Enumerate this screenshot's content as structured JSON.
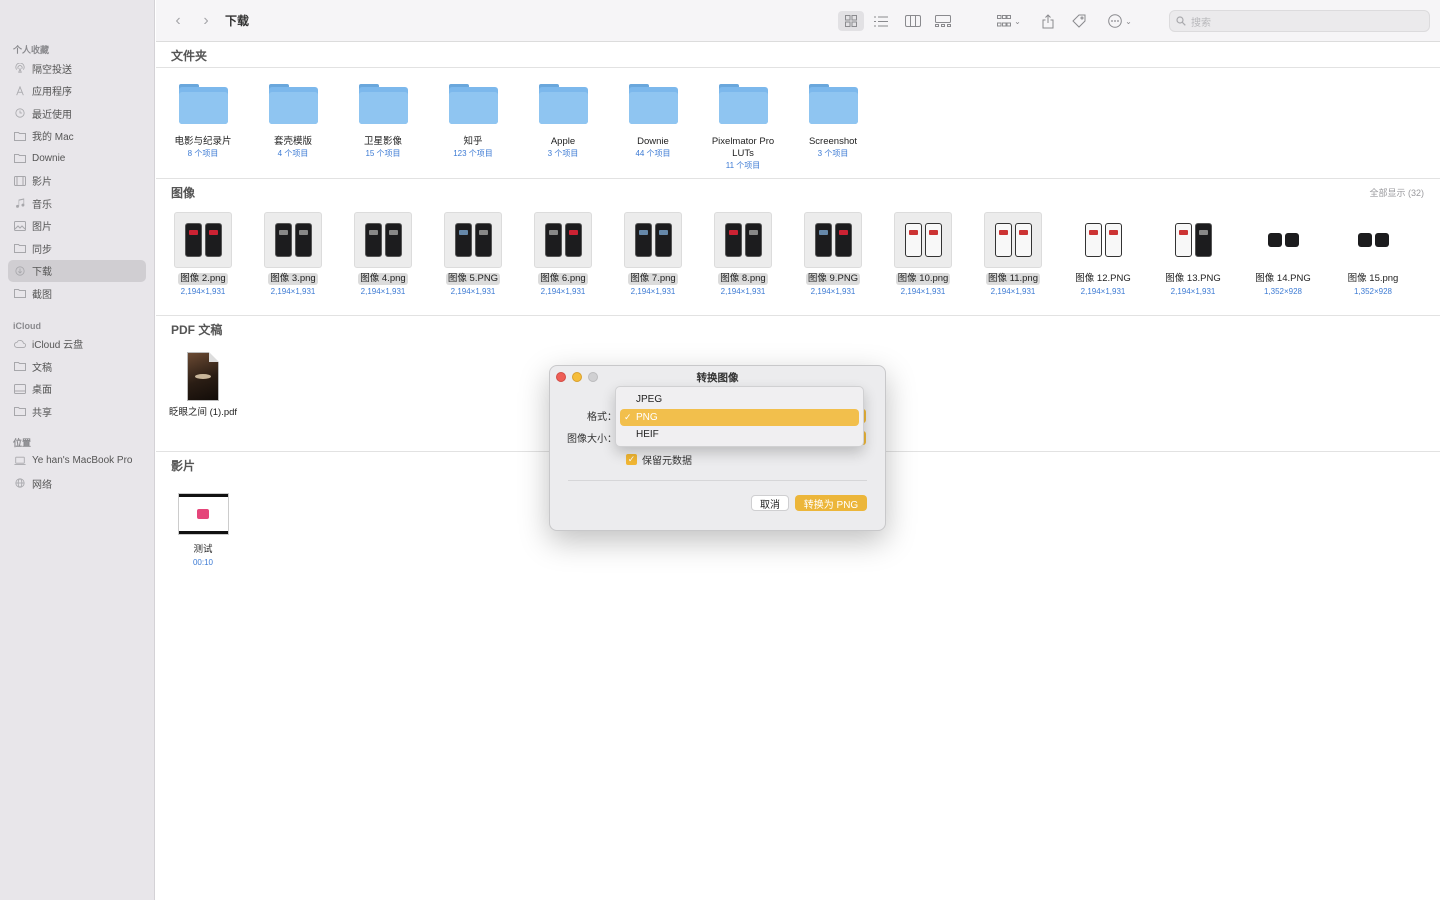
{
  "sidebar": {
    "favorites_title": "个人收藏",
    "favorites": [
      {
        "label": "隔空投送",
        "icon": "airdrop-icon"
      },
      {
        "label": "应用程序",
        "icon": "applications-icon"
      },
      {
        "label": "最近使用",
        "icon": "recents-icon"
      },
      {
        "label": "我的 Mac",
        "icon": "folder-icon"
      },
      {
        "label": "Downie",
        "icon": "folder-icon"
      },
      {
        "label": "影片",
        "icon": "film-icon"
      },
      {
        "label": "音乐",
        "icon": "music-icon"
      },
      {
        "label": "图片",
        "icon": "photo-icon"
      },
      {
        "label": "同步",
        "icon": "folder-icon"
      },
      {
        "label": "下载",
        "icon": "download-icon"
      },
      {
        "label": "截图",
        "icon": "folder-icon"
      }
    ],
    "icloud_title": "iCloud",
    "icloud": [
      {
        "label": "iCloud 云盘",
        "icon": "cloud-icon"
      },
      {
        "label": "文稿",
        "icon": "folder-icon"
      },
      {
        "label": "桌面",
        "icon": "desktop-icon"
      },
      {
        "label": "共享",
        "icon": "shared-folder-icon"
      }
    ],
    "locations_title": "位置",
    "locations": [
      {
        "label": "Ye han's MacBook Pro",
        "icon": "laptop-icon"
      },
      {
        "label": "网络",
        "icon": "globe-icon"
      }
    ]
  },
  "toolbar": {
    "title": "下载",
    "search_placeholder": "搜索"
  },
  "sections": {
    "folders": "文件夹",
    "images": "图像",
    "show_all": "全部显示 (32)",
    "pdf": "PDF 文稿",
    "movies": "影片"
  },
  "folders": [
    {
      "name": "电影与纪录片",
      "count": "8 个项目"
    },
    {
      "name": "套壳模版",
      "count": "4 个项目"
    },
    {
      "name": "卫星影像",
      "count": "15 个项目"
    },
    {
      "name": "知乎",
      "count": "123 个项目"
    },
    {
      "name": "Apple",
      "count": "3 个项目"
    },
    {
      "name": "Downie",
      "count": "44 个项目"
    },
    {
      "name": "Pixelmator Pro\nLUTs",
      "count": "11 个项目"
    },
    {
      "name": "Screenshot",
      "count": "3 个项目"
    }
  ],
  "images": [
    {
      "name": "图像 2.png",
      "size": "2,194×1,931"
    },
    {
      "name": "图像 3.png",
      "size": "2,194×1,931"
    },
    {
      "name": "图像 4.png",
      "size": "2,194×1,931"
    },
    {
      "name": "图像 5.PNG",
      "size": "2,194×1,931"
    },
    {
      "name": "图像 6.png",
      "size": "2,194×1,931"
    },
    {
      "name": "图像 7.png",
      "size": "2,194×1,931"
    },
    {
      "name": "图像 8.png",
      "size": "2,194×1,931"
    },
    {
      "name": "图像 9.PNG",
      "size": "2,194×1,931"
    },
    {
      "name": "图像 10.png",
      "size": "2,194×1,931"
    },
    {
      "name": "图像 11.png",
      "size": "2,194×1,931"
    },
    {
      "name": "图像 12.PNG",
      "size": "2,194×1,931"
    },
    {
      "name": "图像 13.PNG",
      "size": "2,194×1,931"
    },
    {
      "name": "图像 14.PNG",
      "size": "1,352×928"
    },
    {
      "name": "图像 15.png",
      "size": "1,352×928"
    }
  ],
  "pdf": {
    "name": "眨眼之间 (1).pdf"
  },
  "movie": {
    "name": "测试",
    "duration": "00:10"
  },
  "dialog": {
    "title": "转换图像",
    "format_label": "格式：",
    "size_label": "图像大小：",
    "keep_metadata": "保留元数据",
    "cancel": "取消",
    "convert": "转换为 PNG"
  },
  "format_menu": {
    "options": [
      "JPEG",
      "PNG",
      "HEIF"
    ],
    "selected": "PNG"
  },
  "colors": {
    "accent": "#ecb63a",
    "link_blue": "#3d7bd4",
    "folder_blue": "#7cb8ec"
  }
}
